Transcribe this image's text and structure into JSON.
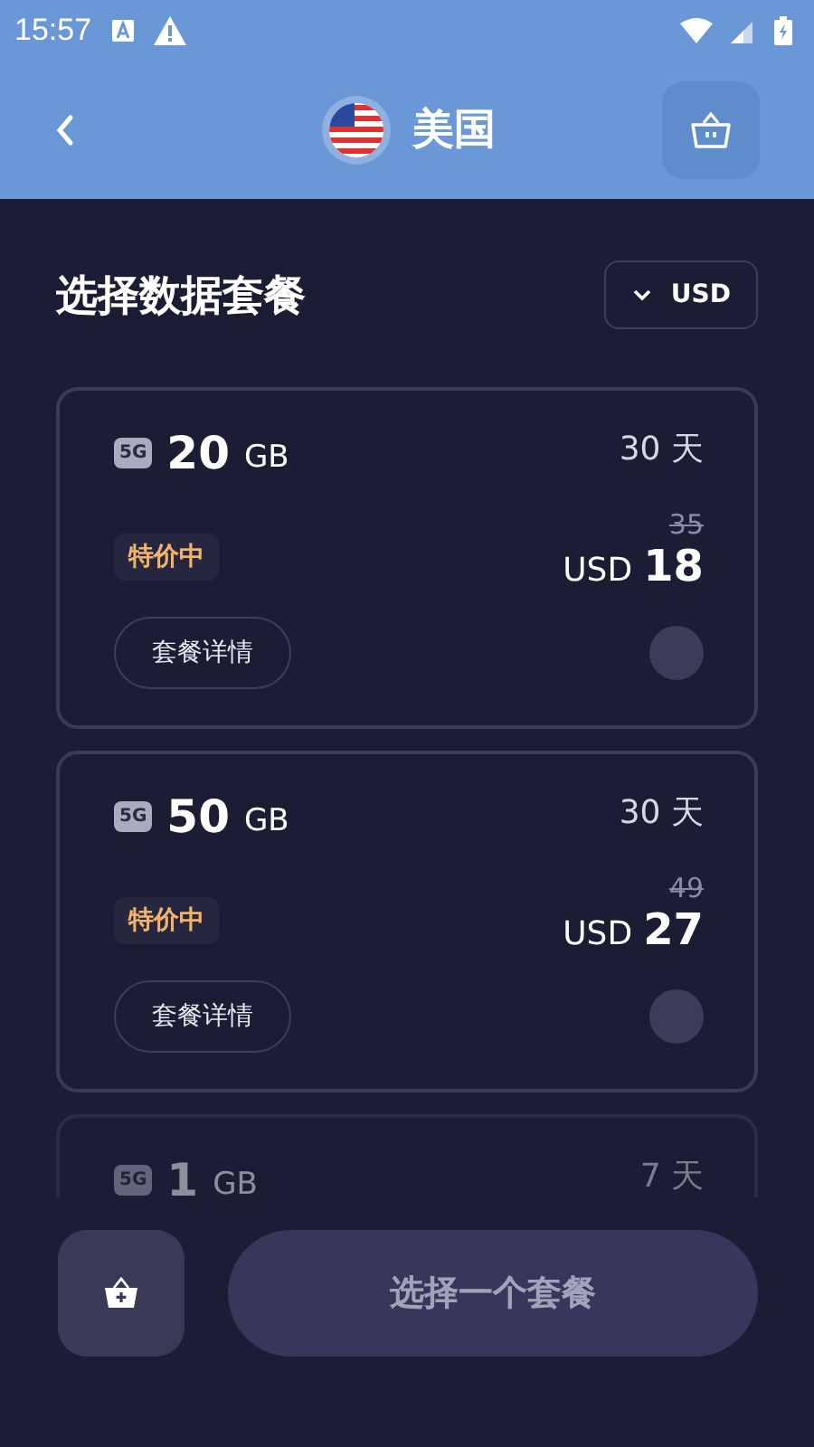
{
  "status_bar": {
    "time": "15:57"
  },
  "header": {
    "title": "美国"
  },
  "section": {
    "title": "选择数据套餐",
    "currency": "USD"
  },
  "plans": [
    {
      "badge": "5G",
      "amount": "20",
      "unit": "GB",
      "duration": "30 天",
      "tag": "特价中",
      "old_price": "35",
      "currency": "USD",
      "price": "18",
      "details": "套餐详情",
      "selected": false
    },
    {
      "badge": "5G",
      "amount": "50",
      "unit": "GB",
      "duration": "30 天",
      "tag": "特价中",
      "old_price": "49",
      "currency": "USD",
      "price": "27",
      "details": "套餐详情",
      "selected": false
    },
    {
      "badge": "5G",
      "amount": "1",
      "unit": "GB",
      "duration": "7 天"
    }
  ],
  "footer": {
    "button": "选择一个套餐"
  }
}
